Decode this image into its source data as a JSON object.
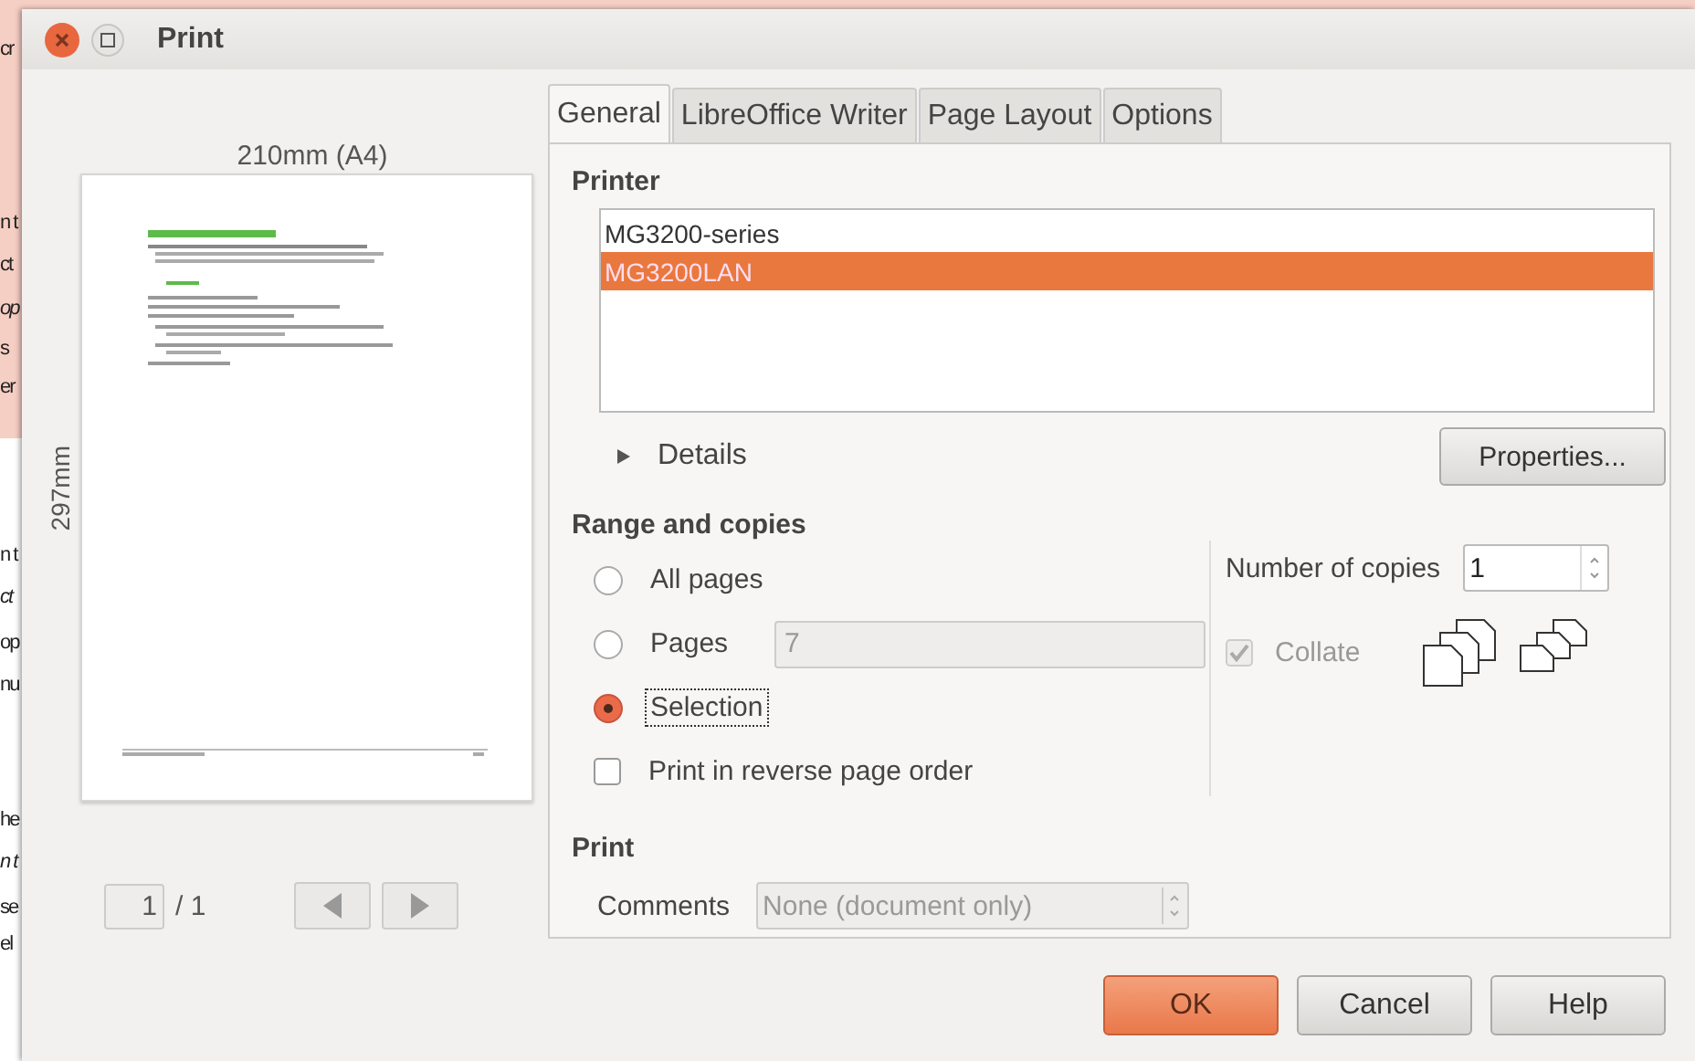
{
  "background_document": {
    "fragments": [
      {
        "text": "cr",
        "shaded": true
      },
      {
        "text": "n t",
        "shaded": true
      },
      {
        "text": "ct",
        "shaded": true
      },
      {
        "text": "op",
        "shaded": true
      },
      {
        "text": "s",
        "shaded": true
      },
      {
        "text": "er",
        "shaded": true
      },
      {
        "text": "n t",
        "shaded": false
      },
      {
        "text": "ct",
        "shaded": false
      },
      {
        "text": "op",
        "shaded": false
      },
      {
        "text": "nu",
        "shaded": false
      },
      {
        "text": "he",
        "shaded": false
      },
      {
        "text": "n t",
        "shaded": false
      },
      {
        "text": "se",
        "shaded": false
      },
      {
        "text": "el",
        "shaded": false
      }
    ]
  },
  "window": {
    "title": "Print"
  },
  "preview": {
    "width_label": "210mm (A4)",
    "height_label": "297mm",
    "page_field": "1",
    "page_total": "/ 1"
  },
  "tabs": [
    {
      "label": "General",
      "selected": true
    },
    {
      "label": "LibreOffice Writer",
      "selected": false
    },
    {
      "label": "Page Layout",
      "selected": false
    },
    {
      "label": "Options",
      "selected": false
    }
  ],
  "printer": {
    "heading": "Printer",
    "printers": [
      {
        "name": "MG3200-series",
        "selected": false
      },
      {
        "name": "MG3200LAN",
        "selected": true
      }
    ],
    "details": {
      "label": "Details",
      "expanded": false
    },
    "properties_button": "Properties..."
  },
  "range": {
    "heading": "Range and copies",
    "options": [
      {
        "label": "All pages",
        "selected": false,
        "focused": false
      },
      {
        "label": "Pages",
        "selected": false,
        "focused": false,
        "field": {
          "value": "7",
          "disabled": true
        }
      },
      {
        "label": "Selection",
        "selected": true,
        "focused": true
      }
    ],
    "reverse": {
      "label": "Print in reverse page order",
      "checked": false
    },
    "copies": {
      "label": "Number of copies",
      "value": "1"
    },
    "collate": {
      "label": "Collate",
      "checked": true,
      "disabled": true
    }
  },
  "print": {
    "heading": "Print",
    "comments": {
      "label": "Comments",
      "value": "None (document only)",
      "disabled": true
    }
  },
  "buttons": [
    {
      "label": "OK",
      "kind": "default"
    },
    {
      "label": "Cancel",
      "kind": "normal"
    },
    {
      "label": "Help",
      "kind": "normal"
    }
  ]
}
